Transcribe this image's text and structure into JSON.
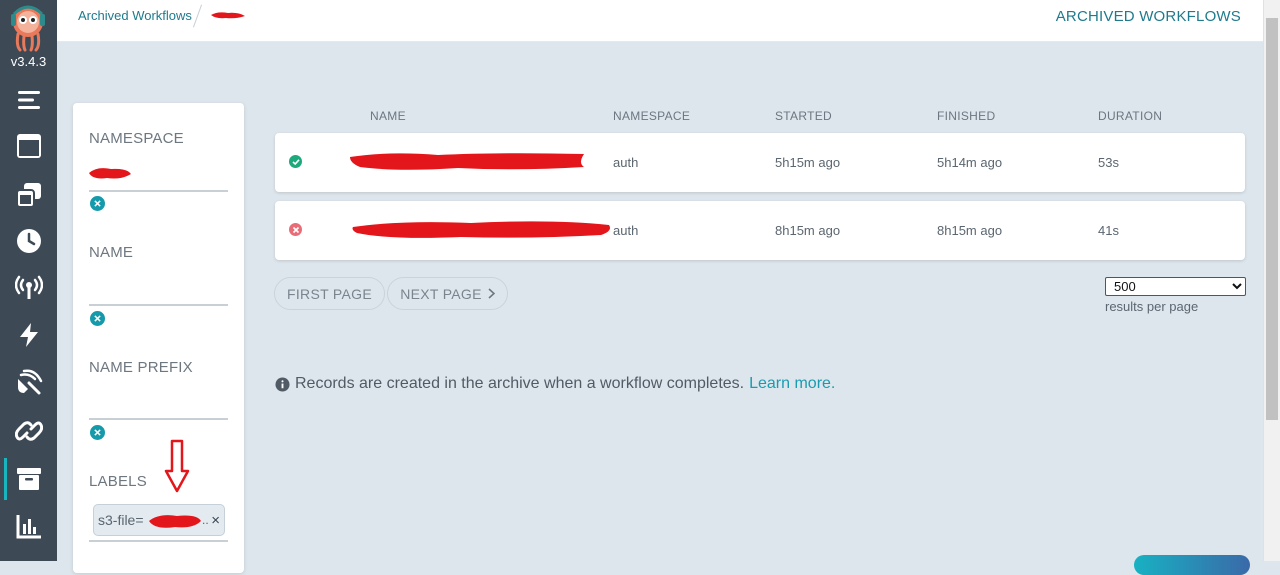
{
  "app": {
    "version": "v3.4.3",
    "brand_colors": {
      "rail": "#3d4a56",
      "accent": "#1ab4c1",
      "link": "#1a9bb0"
    }
  },
  "nav": {
    "items": [
      {
        "icon": "menu-icon"
      },
      {
        "icon": "workflows-icon"
      },
      {
        "icon": "workflow-templates-icon"
      },
      {
        "icon": "clock-icon"
      },
      {
        "icon": "event-sources-icon"
      },
      {
        "icon": "sensors-icon"
      },
      {
        "icon": "event-flow-icon"
      },
      {
        "icon": "link-icon"
      },
      {
        "icon": "archive-icon",
        "active": true
      },
      {
        "icon": "reports-icon"
      }
    ]
  },
  "header": {
    "breadcrumb": "Archived Workflows",
    "title": "ARCHIVED WORKFLOWS"
  },
  "filters": {
    "namespace_label": "NAMESPACE",
    "name_label": "NAME",
    "name_value": "",
    "name_prefix_label": "NAME PREFIX",
    "name_prefix_value": "",
    "labels_label": "LABELS",
    "label_tag_prefix": "s3-file=",
    "label_tag_suffix": "..",
    "remove_tag": "×"
  },
  "table": {
    "columns": [
      "NAME",
      "NAMESPACE",
      "STARTED",
      "FINISHED",
      "DURATION"
    ],
    "rows": [
      {
        "status": "succeeded",
        "namespace": "auth",
        "started": "5h15m ago",
        "finished": "5h14m ago",
        "duration": "53s"
      },
      {
        "status": "failed",
        "namespace": "auth",
        "started": "8h15m ago",
        "finished": "8h15m ago",
        "duration": "41s"
      }
    ]
  },
  "pagination": {
    "first_page": "FIRST PAGE",
    "next_page": "NEXT PAGE",
    "per_page_value": "500",
    "per_page_caption": "results per page"
  },
  "info": {
    "message": "Records are created in the archive when a workflow completes.",
    "link_text": "Learn more."
  },
  "status_colors": {
    "succeeded": "#1ea97c",
    "failed": "#e96d76"
  }
}
